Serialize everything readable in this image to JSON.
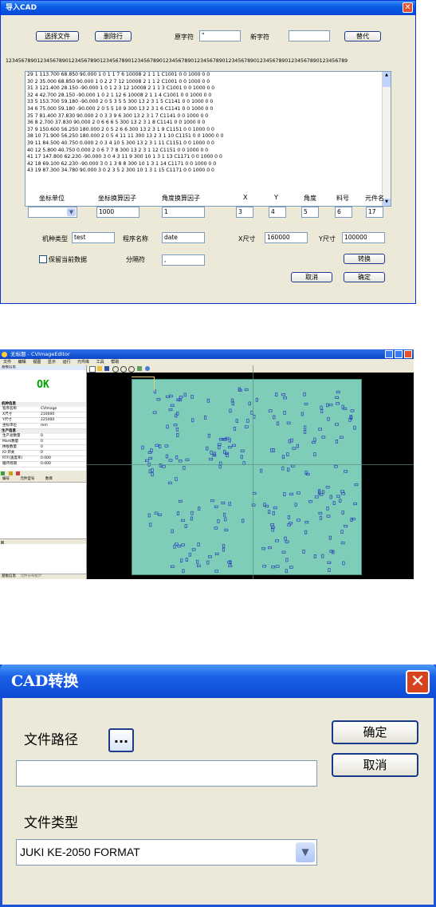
{
  "import_dialog": {
    "title": "导入CAD",
    "select_file": "选择文件",
    "delete_row": "删除行",
    "original_char_label": "原字符",
    "original_char_value": "\"",
    "new_char_label": "新字符",
    "new_char_value": "",
    "replace": "替代",
    "ruler": "1234567890123456789012345678901234567890123456789012345678901234567890123456789012345678901234567890123456789",
    "lines": [
      "29 1 113.700 68.850 90.000 1 0 1 1 7 6 10008 2 1 1 1  C1001  0 0 1000 0 0",
      "30 2 35.000 68.850 90.000 1 0 2 2 7 12 10008 2 1 1 2  C1001  0 0 1000 0 0",
      "31 3 121.400 28.150 -90.000 1 0 1 2 3 12 10008 2 1 1 3  C1001  0 0 1000 0 0",
      "32 4 42.700 28.150 -90.000 1 0 2 1 12 6 10008 2 1 1 4  C1001  0 0 1000 0 0",
      "33 5 153.700 59.180 -90.000 2 0 5 3 5 5 300 13 2 3 1 5  C1141  0 0 1000 0 0",
      "34 6 75.000 59.180 -90.000 2 0 5 5 10 9 300 13 2 3 1 6  C1141  0 0 1000 0 0",
      "35 7 81.400 37.830 90.000 2 0 3 3 9 6 300 13 2 3 1 7  C1141  0 0 1000 0 0",
      "36 8 2.700 37.830 90.000 2 0 6 6 6 5 300 13 2 3 1 8  C1141  0 0 1000 0 0",
      "37 9 150.600 56.250 180.000 2 0 5 2 6 6 300 13 2 3 1 9  C1151  0 0 1000 0 0",
      "38 10 71.900 56.250 180.000 2 0 5 4 11 11 300 13 2 3 1 10  C1151  0 0 1000 0 0",
      "39 11 84.500 40.750 0.000 2 0 3 4 10 5 300 13 2 3 1 11  C1151  0 0 1000 0 0",
      "40 12 5.800 40.750 0.000 2 0 6 7 7 8 300 13 2 3 1 12  C1151  0 0 1000 0 0",
      "41 17 147.800 62.230 -90.000 3 0 4 3 11 9 300 10 1 3 1 13  C1171  0 0 1000 0 0",
      "42 18 69.100 62.230 -90.000 3 0 1 3 8 8 300 10 1 3 1 14  C1171  0 0 1000 0 0",
      "43 19 87.300 34.780 90.000 3 0 2 3 5 2 300 10 1 3 1 15  C1171  0 0 1000 0 0"
    ],
    "headers": {
      "coord_unit": "坐标单位",
      "coord_factor": "坐标换算因子",
      "angle_factor": "角度换算因子",
      "x": "X",
      "y": "Y",
      "angle": "角度",
      "part_no": "料号",
      "comp_name": "元件名"
    },
    "values": {
      "coord_factor": "1000",
      "angle_factor": "1",
      "x": "3",
      "y": "4",
      "angle": "5",
      "part_no": "6",
      "comp_name": "17"
    },
    "machine_type_label": "机种类型",
    "machine_type_value": "test",
    "program_name_label": "程序名称",
    "program_name_value": "date",
    "x_size_label": "X尺寸",
    "x_size_value": "160000",
    "y_size_label": "Y尺寸",
    "y_size_value": "100000",
    "keep_data_label": "保留当前数据",
    "separator_label": "分隔符",
    "separator_value": ",",
    "convert": "转换",
    "cancel": "取消",
    "ok": "确定"
  },
  "app": {
    "title": "无标题 - CVImageEditor",
    "menu": [
      "文件",
      "编辑",
      "视图",
      "显示",
      "运行",
      "元件库",
      "工具",
      "帮助"
    ],
    "panel_title": "基板信息",
    "status_ok": "OK",
    "section_machine": "机种信息",
    "machine_rows": [
      [
        "程序名称",
        "CVImage"
      ],
      [
        "X尺寸",
        "210000"
      ],
      [
        "Y尺寸",
        "225000"
      ],
      [
        "坐标单位",
        "mm"
      ]
    ],
    "section_production": "生产信息",
    "production_rows": [
      [
        "生产总数量",
        "0"
      ],
      [
        "Mark数量",
        "0"
      ],
      [
        "拼板数量",
        "0"
      ],
      [
        "IO 开关",
        "0"
      ],
      [
        "RTF(速度率)",
        "0.000"
      ],
      [
        "循环周期",
        "0.000"
      ]
    ],
    "list_headers": [
      "编号",
      "元件型号",
      "数目"
    ],
    "bottom_tabs": [
      "基板信息",
      "元件分布统计"
    ]
  },
  "cad_dialog": {
    "title": "CAD转换",
    "file_path_label": "文件路径",
    "browse": "...",
    "file_path_value": "",
    "ok": "确定",
    "cancel": "取消",
    "file_type_label": "文件类型",
    "file_type_value": "JUKI KE-2050 FORMAT"
  },
  "colors": {
    "xp_blue": "#0a5ce6",
    "board": "#7ecdb8",
    "ok_green": "#00a000"
  }
}
